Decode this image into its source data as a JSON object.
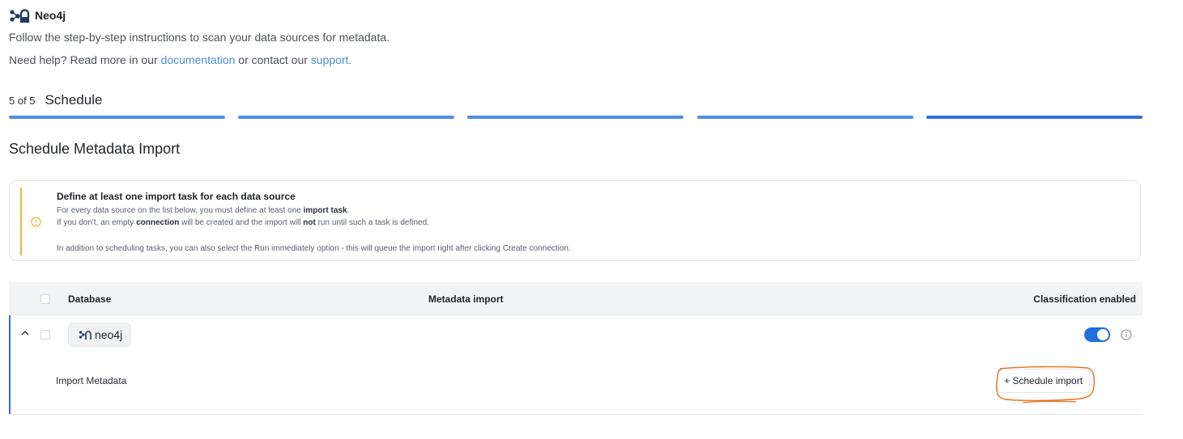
{
  "header": {
    "brand_name": "Neo4j"
  },
  "intro": {
    "text": "Follow the step-by-step instructions to scan your data sources for metadata."
  },
  "help": {
    "prefix": "Need help? Read more in our ",
    "documentation_link": "documentation",
    "middle": " or contact our ",
    "support_link": "support."
  },
  "stepper": {
    "counter": "5 of 5",
    "title": "Schedule",
    "current_step": 5,
    "total_steps": 5,
    "colors": {
      "completed": "#4e8fe3",
      "current": "#2f70d2"
    }
  },
  "section_title": "Schedule Metadata Import",
  "notice": {
    "title": "Define at least one import task for each data source",
    "line1_pre": "For every data source on the list below, you must define at least one ",
    "line1_bold": "import task",
    "line1_post": ".",
    "line2_pre": "If you don't, an empty ",
    "line2_bold1": "connection",
    "line2_mid": " will be created and the import will ",
    "line2_bold2": "not",
    "line2_post": " run until such a task is defined.",
    "line3": "In addition to scheduling tasks, you can also select the Run immediately option - this will queue the import right after clicking Create connection.",
    "accent_color": "#e8b73c"
  },
  "table": {
    "columns": {
      "database": "Database",
      "metadata_import": "Metadata import",
      "classification": "Classification enabled"
    },
    "rows": [
      {
        "database_name": "neo4j",
        "classification_enabled": true,
        "import_label": "Import Metadata",
        "schedule_button": "+ Schedule import"
      }
    ]
  },
  "icons": {
    "brand": "neo4j-logo-icon",
    "warning": "warning-circle-icon",
    "chevron": "chevron-up-icon",
    "database": "neo4j-icon",
    "info": "info-icon"
  },
  "colors": {
    "link": "#4a8fd8",
    "toggle_on": "#1f6fe0",
    "annotation": "#e8731f"
  }
}
